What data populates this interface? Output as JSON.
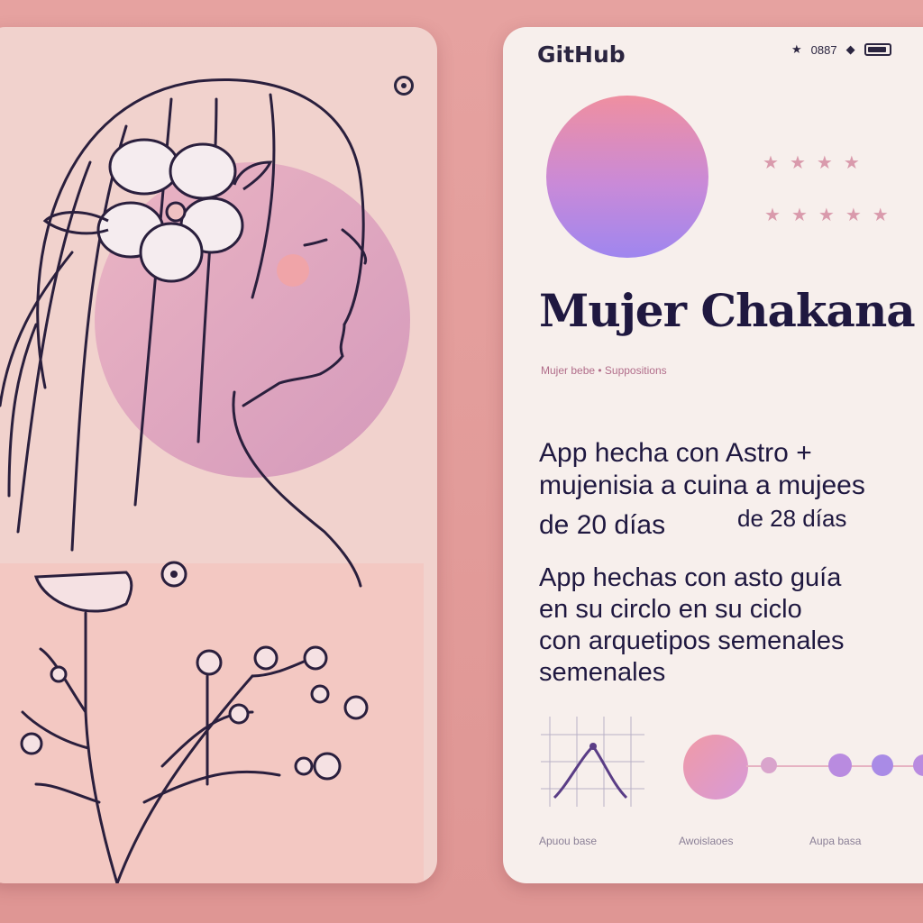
{
  "app": {
    "brand": "GitHub",
    "status_text": "0887",
    "title": "Mujer Chakana",
    "subline": "Mujer bebe  •  Suppositions"
  },
  "description": {
    "block1": [
      "App hecha con Astro +",
      "mujenisia a cuina a mujees",
      "de  20  días",
      "de 28 días"
    ],
    "block2": [
      "App hechas  con asto guía",
      "en su circlo en su ciclo",
      "con arquetipos semenales",
      "semenales"
    ]
  },
  "footer": {
    "labels": [
      "Apuou base",
      "Awoislaoes",
      "Aupa basa"
    ]
  },
  "icons": {
    "top_left_card_icon": "info-dot-icon",
    "status_icons": [
      "star-icon",
      "drop-icon",
      "battery-icon"
    ]
  },
  "colors": {
    "background": "#e39a98",
    "card_left": "#f1d2cd",
    "card_right": "#f7efec",
    "ink": "#2b2540",
    "accent_pink": "#ef8fa0",
    "accent_purple": "#9f86ef"
  }
}
